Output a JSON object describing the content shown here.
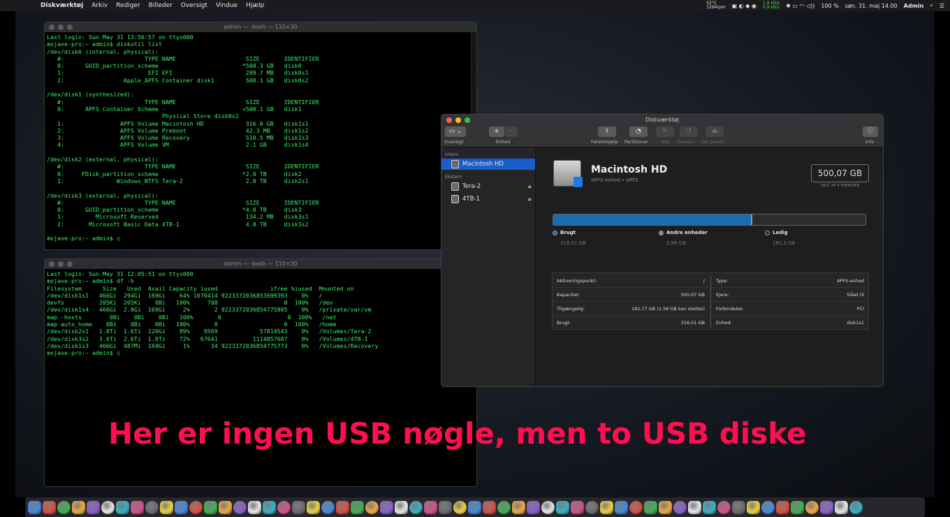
{
  "menubar": {
    "app": "Diskværktøj",
    "menus": [
      "Arkiv",
      "Rediger",
      "Billeder",
      "Oversigt",
      "Vindue",
      "Hjælp"
    ],
    "status": {
      "temp": "52°C",
      "rpm": "1294rpm",
      "net_up": "1,9 kB/s",
      "net_down": "0,9 kB/s",
      "battery": "100 %",
      "date": "søn. 31. maj 14.00",
      "user": "Admin"
    }
  },
  "term1": {
    "title": "admin — -bash — 110×30",
    "lines": [
      "Last login: Sun May 31 13:56:57 on ttys000",
      "mojave-pro:~ admin$ diskutil list",
      "/dev/disk0 (internal, physical):",
      "   #:                       TYPE NAME                    SIZE       IDENTIFIER",
      "   0:      GUID_partition_scheme                        *500.3 GB   disk0",
      "   1:                        EFI EFI                     209.7 MB   disk0s1",
      "   2:                 Apple_APFS Container disk1         500.1 GB   disk0s2",
      "",
      "/dev/disk1 (synthesized):",
      "   #:                       TYPE NAME                    SIZE       IDENTIFIER",
      "   0:      APFS Container Scheme -                      +500.1 GB   disk1",
      "                                 Physical Store disk0s2",
      "   1:                APFS Volume Macintosh HD            316.0 GB   disk1s1",
      "   2:                APFS Volume Preboot                 42.3 MB    disk1s2",
      "   3:                APFS Volume Recovery                510.5 MB   disk1s3",
      "   4:                APFS Volume VM                      2.1 GB     disk1s4",
      "",
      "/dev/disk2 (external, physical):",
      "   #:                       TYPE NAME                    SIZE       IDENTIFIER",
      "   0:     FDisk_partition_scheme                        *2.0 TB     disk2",
      "   1:               Windows_NTFS Tera-2                  2.0 TB     disk2s1",
      "",
      "/dev/disk3 (external, physical):",
      "   #:                       TYPE NAME                    SIZE       IDENTIFIER",
      "   0:      GUID_partition_scheme                        *4.0 TB     disk3",
      "   1:         Microsoft Reserved                         134.2 MB   disk3s1",
      "   2:       Microsoft Basic Data 4TB-1                   4.0 TB     disk3s2",
      "",
      "mojave-pro:~ admin$ ▯"
    ]
  },
  "term2": {
    "title": "admin — -bash — 110×30",
    "lines": [
      "Last login: Sun May 31 12:05:51 on ttys000",
      "mojave-pro:~ admin$ df -h",
      "Filesystem      Size   Used  Avail Capacity iused               ifree %iused  Mounted on",
      "/dev/disk1s1   466Gi  294Gi  169Gi    64% 1076414 9223372036853699393    0%   /",
      "devfs          205Ki  205Ki    0Bi   100%     708                   0  100%   /dev",
      "/dev/disk1s4   466Gi  2.0Gi  169Gi     2%       2 9223372036854775805    0%   /private/var/vm",
      "map -hosts        0Bi    0Bi    0Bi   100%       0                   0  100%   /net",
      "map auto_home    0Bi    0Bi    0Bi   100%       0                   0  100%   /home",
      "/dev/disk2s1   1.8Ti  1.6Ti  220Gi    89%    9569            57814543    0%   /Volumes/Tera-2",
      "/dev/disk3s2   3.6Ti  2.6Ti  1.0Ti    72%   67641          1114857687    0%   /Volumes/4TB-1",
      "/dev/disk1s3   466Gi  487Mi  169Gi     1%      34 9223372036854775773    0%   /Volumes/Recovery",
      "mojave-pro:~ admin$ ▯"
    ]
  },
  "du": {
    "title": "Diskværktøj",
    "toolbar": {
      "view": "Oversigt",
      "enhed": "Enhed",
      "plus": "+",
      "minus": "−",
      "first_aid": "Førstehjælp",
      "partition": "Partitioner",
      "erase": "Slet",
      "restore": "Gendan",
      "unmount": "Gør passiv",
      "info": "Info"
    },
    "sidebar": {
      "intern_header": "Intern",
      "ekstern_header": "Ekstern",
      "intern": [
        {
          "label": "Macintosh HD"
        }
      ],
      "ekstern": [
        {
          "label": "Tera-2"
        },
        {
          "label": "4TB-1"
        }
      ]
    },
    "volume": {
      "name": "Macintosh HD",
      "subtitle": "APFS-enhed • APFS",
      "capacity": "500,07 GB",
      "shared_note": "DELT AF 4 ENHEDER",
      "used_fraction": 0.638
    },
    "legend": [
      {
        "label": "Brugt",
        "value": "318,01 GB",
        "color": "#1b6cb0"
      },
      {
        "label": "Andre enheder",
        "value": "2,86 GB",
        "color": "#8a8a8a"
      },
      {
        "label": "Ledig",
        "value": "181,2 GB",
        "color": "#2c2c2e"
      }
    ],
    "info_left": [
      {
        "k": "Aktiveringspunkt:",
        "v": "/"
      },
      {
        "k": "Kapacitet:",
        "v": "500,07 GB"
      },
      {
        "k": "Tilgængelig:",
        "v": "182,77 GB (1,56 GB kan slettes)"
      },
      {
        "k": "Brugt:",
        "v": "316,01 GB"
      }
    ],
    "info_right": [
      {
        "k": "Type:",
        "v": "APFS-enhed"
      },
      {
        "k": "Ejere:",
        "v": "Slået til"
      },
      {
        "k": "Forbindelse:",
        "v": "PCI"
      },
      {
        "k": "Enhed:",
        "v": "disk1s1"
      }
    ]
  },
  "overlay": "Her er ingen USB nøgle, men to USB diske",
  "dock": {
    "icons": [
      "finder-icon",
      "launchpad-icon",
      "safari-icon",
      "appstore-icon",
      "notes-icon",
      "vector-icon",
      "smile-icon",
      "rocket-icon",
      "chrome-icon",
      "chrome-canary-icon",
      "firefox-icon",
      "safari-tech-icon",
      "opera-icon",
      "filezilla-icon",
      "globe-icon",
      "globe2-icon",
      "globe3-icon",
      "preview-icon",
      "books-icon",
      "calendar-icon",
      "notes2-icon",
      "messages-icon",
      "facetime-icon",
      "photos-icon",
      "finder2-icon",
      "terminal-icon",
      "sublime-icon",
      "textedit-icon",
      "xcode-icon",
      "pages-icon",
      "numbers-icon",
      "keynote-icon",
      "itunes-icon",
      "photobooth-icon",
      "utilities-icon",
      "archive-icon",
      "brush-icon",
      "console-icon",
      "activity-icon",
      "disk-utility-icon",
      "preferences-icon",
      "installer-icon",
      "steam-icon",
      "network-icon",
      "crystal-icon",
      "globe4-icon",
      "globe5-icon",
      "globe6-icon",
      "malware-icon",
      "sun-icon",
      "cards-icon",
      "word-icon",
      "apps-icon",
      "red-icon",
      "blue-icon",
      "downloads-icon",
      "trash-icon"
    ]
  }
}
